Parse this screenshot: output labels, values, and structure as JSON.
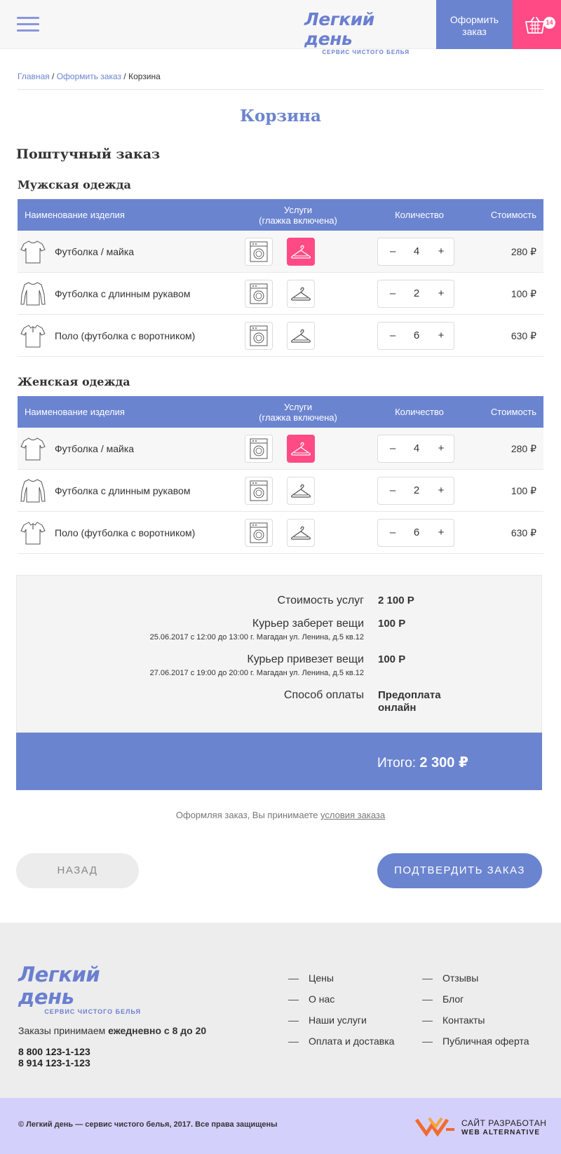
{
  "header": {
    "logo_title": "Легкий день",
    "logo_subtitle": "сервис чистого белья",
    "order_label": "Оформить заказ",
    "cart_count": "14"
  },
  "breadcrumb": {
    "home": "Главная",
    "separator": "/",
    "order": "Оформить заказ",
    "current": "Корзина"
  },
  "page_title": "Корзина",
  "section_title": "Поштучный заказ",
  "table_headers": {
    "name": "Наименование изделия",
    "services_line1": "Услуги",
    "services_line2": "(глажка включена)",
    "quantity": "Количество",
    "cost": "Стоимость"
  },
  "categories": [
    {
      "title": "Мужская одежда",
      "items": [
        {
          "icon": "tshirt-icon",
          "name": "Футболка / майка",
          "iron_active": true,
          "qty": "4",
          "cost": "280 ₽"
        },
        {
          "icon": "longsleeve-icon",
          "name": "Футболка с длинным рукавом",
          "iron_active": false,
          "qty": "2",
          "cost": "100 ₽"
        },
        {
          "icon": "polo-icon",
          "name": "Поло (футболка с воротником)",
          "iron_active": false,
          "qty": "6",
          "cost": "630 ₽"
        }
      ]
    },
    {
      "title": "Женская одежда",
      "items": [
        {
          "icon": "tshirt-icon",
          "name": "Футболка / майка",
          "iron_active": true,
          "qty": "4",
          "cost": "280 ₽"
        },
        {
          "icon": "longsleeve-icon",
          "name": "Футболка с длинным рукавом",
          "iron_active": false,
          "qty": "2",
          "cost": "100 ₽"
        },
        {
          "icon": "polo-icon",
          "name": "Поло (футболка с воротником)",
          "iron_active": false,
          "qty": "6",
          "cost": "630 ₽"
        }
      ]
    }
  ],
  "qty_minus": "–",
  "qty_plus": "+",
  "summary": {
    "services_label": "Стоимость услуг",
    "services_value": "2 100 Р",
    "pickup_label": "Курьер заберет вещи",
    "pickup_details": "25.06.2017 с 12:00 до 13:00  г. Магадан ул. Ленина, д.5 кв.12",
    "pickup_value": "100 Р",
    "delivery_label": "Курьер привезет вещи",
    "delivery_details": "27.06.2017 с 19:00 до 20:00 г. Магадан ул. Ленина, д.5 кв.12",
    "delivery_value": "100 Р",
    "payment_label": "Способ оплаты",
    "payment_value_line1": "Предоплата",
    "payment_value_line2": "онлайн",
    "total_label": "Итого:",
    "total_value": "2 300 ₽"
  },
  "terms": {
    "text": "Оформляя заказ, Вы принимаете",
    "link": "условия заказа"
  },
  "buttons": {
    "back": "НАЗАД",
    "confirm": "ПОДТВЕРДИТЬ ЗАКАЗ"
  },
  "footer": {
    "logo_title": "Легкий день",
    "logo_subtitle": "сервис чистого белья",
    "hours_prefix": "Заказы  принимаем",
    "hours_bold": "ежедневно с 8 до 20",
    "phone1": "8 800 123-1-123",
    "phone2": "8 914  123-1-123",
    "links_col1": [
      "Цены",
      "О нас",
      "Наши услуги",
      "Оплата и доставка"
    ],
    "links_col2": [
      "Отзывы",
      "Блог",
      "Контакты",
      "Публичная оферта"
    ],
    "copyright": "© Легкий день — сервис чистого белья, 2017. Все права защищены",
    "dev_line1": "САЙТ РАЗРАБОТАН",
    "dev_line2": "WEB ALTERNATIVE"
  },
  "colors": {
    "accent": "#6b84d0",
    "pink": "#ff4a86",
    "footer_bar": "#d4d0fc"
  }
}
